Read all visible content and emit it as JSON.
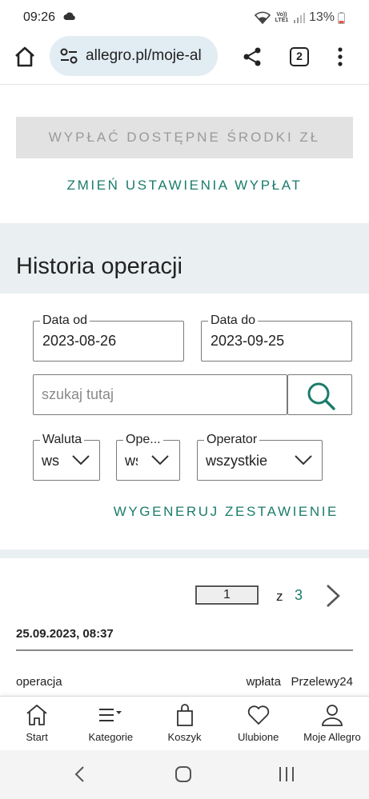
{
  "status_bar": {
    "time": "09:26",
    "battery": "13%",
    "volte": "Vo)) LTE1"
  },
  "browser": {
    "url": "allegro.pl/moje-al",
    "tab_count": "2"
  },
  "payout": {
    "button_label": "WYPŁAĆ DOSTĘPNE ŚRODKI ZŁ",
    "settings_link": "ZMIEŃ USTAWIENIA WYPŁAT"
  },
  "history": {
    "title": "Historia operacji",
    "date_from": {
      "label": "Data od",
      "value": "2023-08-26"
    },
    "date_to": {
      "label": "Data do",
      "value": "2023-09-25"
    },
    "search": {
      "placeholder": "szukaj tutaj"
    },
    "filters": [
      {
        "label": "Waluta",
        "value": "ws"
      },
      {
        "label": "Ope...",
        "value": "ws"
      },
      {
        "label": "Operator",
        "value": "wszystkie"
      }
    ],
    "generate_link": "WYGENERUJ ZESTAWIENIE"
  },
  "pagination": {
    "current": "1",
    "of_label": "z",
    "total": "3"
  },
  "operation": {
    "datetime": "25.09.2023, 08:37",
    "label": "operacja",
    "type": "wpłata",
    "operator": "Przelewy24"
  },
  "bottom_nav": [
    {
      "label": "Start",
      "icon": "home-icon"
    },
    {
      "label": "Kategorie",
      "icon": "menu-icon"
    },
    {
      "label": "Koszyk",
      "icon": "bag-icon"
    },
    {
      "label": "Ulubione",
      "icon": "heart-icon"
    },
    {
      "label": "Moje Allegro",
      "icon": "user-icon"
    }
  ],
  "colors": {
    "accent": "#1b7c6b",
    "band": "#eaeff1",
    "url_pill": "#e2ecf3"
  }
}
